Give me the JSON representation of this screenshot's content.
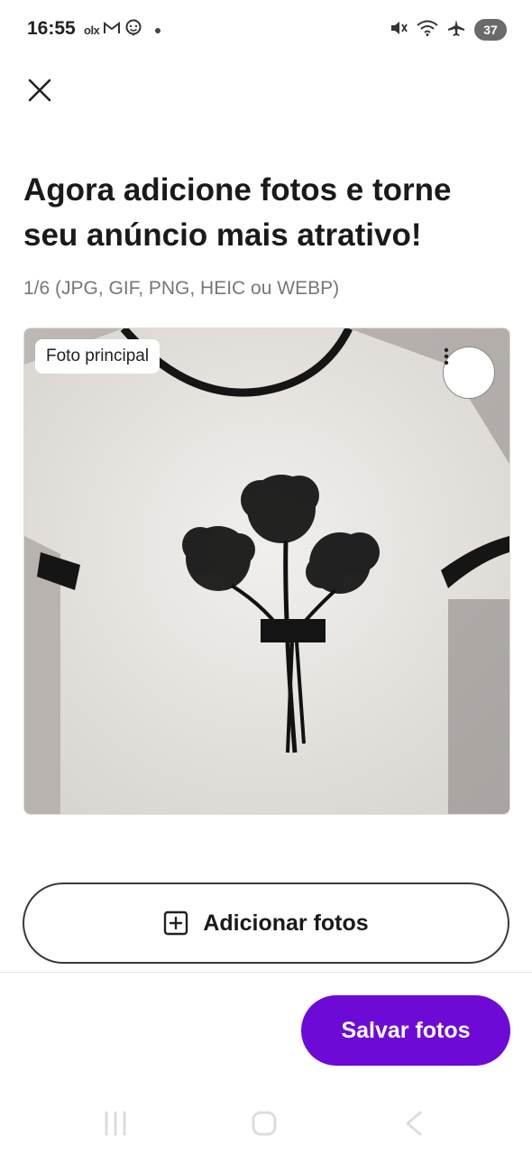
{
  "status_bar": {
    "time": "16:55",
    "app_icons": [
      "olx-icon",
      "gmail-icon",
      "chat-icon",
      "dot-icon"
    ],
    "olx_glyph": "olx",
    "right_icons": [
      "mute-icon",
      "wifi-icon",
      "airplane-icon"
    ],
    "battery": "37"
  },
  "header": {
    "close_icon": "close-icon"
  },
  "main": {
    "title": "Agora adicione fotos e torne seu anúncio mais atrativo!",
    "subtitle": "1/6 (JPG, GIF, PNG, HEIC ou WEBP)",
    "photo": {
      "badge": "Foto principal",
      "menu_icon": "kebab-icon"
    },
    "add_photos_label": "Adicionar fotos",
    "add_photos_icon": "plus-square-icon"
  },
  "footer": {
    "save_label": "Salvar fotos",
    "save_color": "#6e0ad6"
  },
  "nav_bar": {
    "icons": [
      "recent-apps-icon",
      "home-icon",
      "back-icon"
    ]
  }
}
